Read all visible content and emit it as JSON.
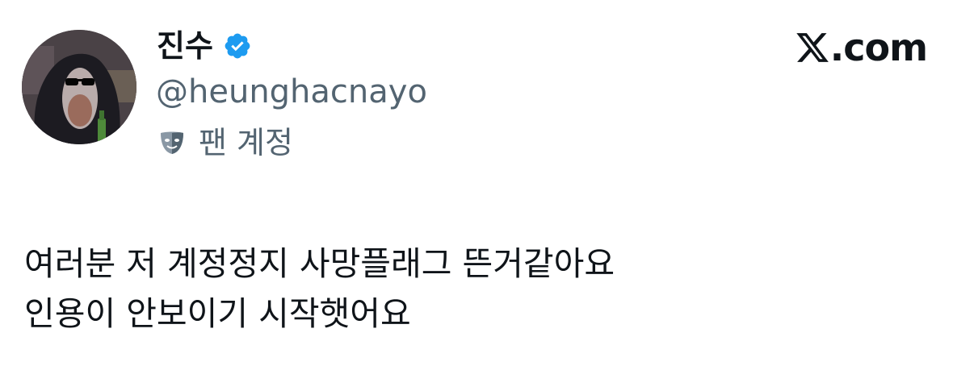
{
  "author": {
    "display_name": "진수",
    "handle": "@heunghacnayo",
    "account_label": "팬 계정",
    "verified": true,
    "avatar_icon": "gorilla-avatar-icon",
    "label_icon": "theater-mask-icon"
  },
  "brand": {
    "text": ".com",
    "logo_icon": "x-logo-icon"
  },
  "tweet": {
    "lines": [
      "여러분 저 계정정지 사망플래그 뜬거같아요",
      "인용이 안보이기 시작햇어요"
    ]
  },
  "colors": {
    "text_primary": "#0f1419",
    "text_secondary": "#536471",
    "verified_blue": "#1d9bf0",
    "background": "#ffffff"
  }
}
